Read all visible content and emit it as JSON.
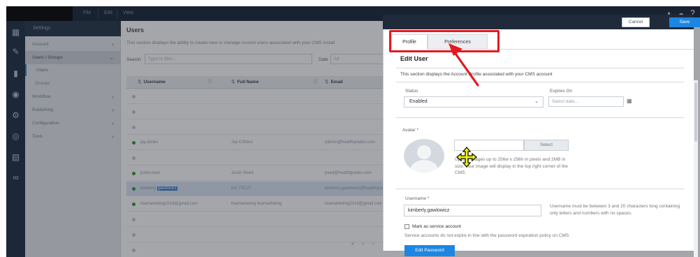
{
  "app": {
    "menu": [
      "File",
      "Edit",
      "View"
    ]
  },
  "nav": {
    "header": "Settings",
    "items": [
      {
        "label": "Account",
        "chevron": "›"
      },
      {
        "label": "Users / Groups",
        "chevron": "⌄"
      },
      {
        "label": "Users"
      },
      {
        "label": "Groups"
      },
      {
        "label": "Workflow",
        "chevron": "›"
      },
      {
        "label": "Publishing",
        "chevron": "›"
      },
      {
        "label": "Configuration",
        "chevron": "›"
      },
      {
        "label": "Tools",
        "chevron": "›"
      }
    ]
  },
  "users_page": {
    "title": "Users",
    "description": "This section displays the ability to create new or manage current users associated with your CMS install",
    "search_label": "Search",
    "search_placeholder": "Type to filter...",
    "date_label": "Date",
    "date_value": "All",
    "columns": {
      "username": "Username",
      "full_name": "Full Name",
      "email": "Email"
    },
    "rows": [
      {
        "username": "",
        "full_name": "",
        "email": "",
        "status": "none"
      },
      {
        "username": "",
        "full_name": "",
        "email": "",
        "status": "none"
      },
      {
        "username": "",
        "full_name": "",
        "email": "",
        "status": "none"
      },
      {
        "username": "jay.obrien",
        "full_name": "Jay O'Brien",
        "email": "jobrien@healthgrades.com",
        "status": "active"
      },
      {
        "username": "",
        "full_name": "",
        "email": "",
        "status": "none"
      },
      {
        "username": "justin.reed",
        "full_name": "Justin Reed",
        "email": "jreed@healthgrades.com",
        "status": "active"
      },
      {
        "username_prefix": "kimberly.",
        "username_highlight": "gawlowicz",
        "full_name": "KG TSC27",
        "email": "kimberly.gawlowicz@healthgrades",
        "status": "active"
      },
      {
        "username": "lisamarketing2018@gmail.com",
        "full_name": "lisamarketing lisamarketing",
        "email": "lisamarketing2018@gmail.com",
        "status": "active"
      },
      {
        "username": "",
        "full_name": "",
        "email": "",
        "status": "none"
      },
      {
        "username": "",
        "full_name": "",
        "email": "",
        "status": "none"
      },
      {
        "username": "",
        "full_name": "",
        "email": "",
        "status": "none"
      }
    ],
    "pager": "« ‹ › »"
  },
  "panel": {
    "cancel_label": "Cancel",
    "save_label": "Save",
    "tabs": [
      {
        "label": "Profile",
        "active": true
      },
      {
        "label": "Preferences",
        "active": false
      }
    ],
    "title": "Edit User",
    "description": "This section displays the Account Profile associated with your CMS account",
    "status": {
      "label": "Status",
      "value": "Enabled"
    },
    "expires": {
      "label": "Expires On",
      "placeholder": "Select date..."
    },
    "avatar": {
      "label": "Avatar *",
      "select_label": "Select",
      "help": "Upload images up to 256w x 256h in pixels and 2MB in size. Your image will display in the top right corner of the CMS."
    },
    "username": {
      "label": "Username *",
      "value": "kimberly.gawlowicz",
      "help": "Username must be between 3 and 20 characters long containing only letters and numbers with no spaces."
    },
    "service_account": {
      "label": "Mark as service account",
      "help": "Service accounts do not expire in line with the password expiration policy on CMS."
    },
    "edit_password_label": "Edit Password"
  },
  "colors": {
    "primary_button": "#1c86e3",
    "annotation": "#e3191f",
    "status_active": "#3a9a3a",
    "topbar": "#1f2b3a"
  },
  "icons": {
    "top": [
      "bell-icon",
      "cloud-icon",
      "help-icon"
    ],
    "rail": [
      "dashboard-icon",
      "edit-icon",
      "analytics-icon",
      "globe-icon",
      "settings-icon",
      "web-icon",
      "grid-icon",
      "infinity-icon"
    ]
  }
}
